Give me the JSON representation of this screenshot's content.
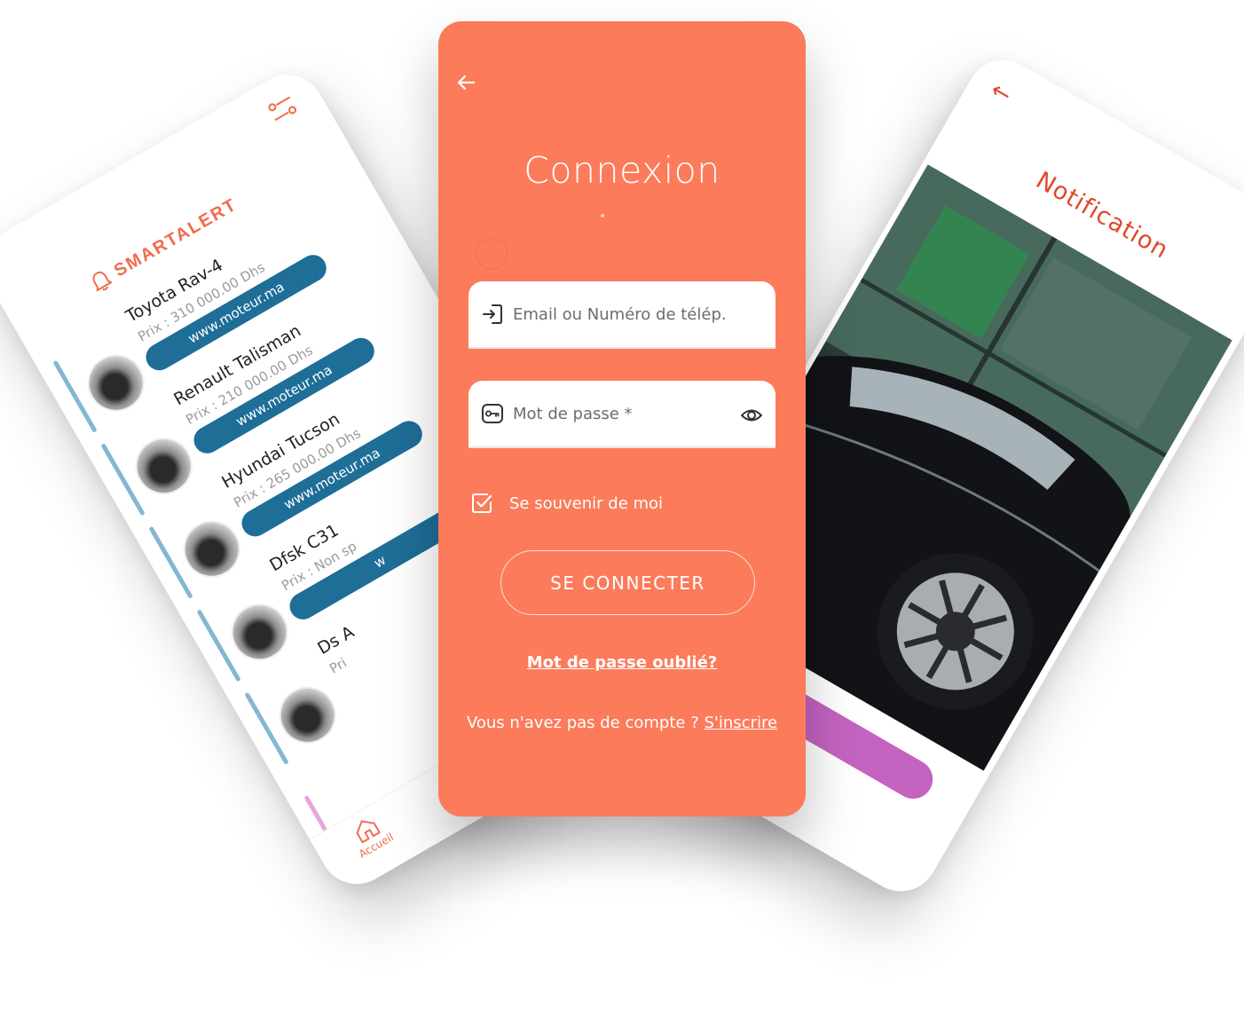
{
  "colors": {
    "accent": "#fb7b5b",
    "brand_red": "#f26b4b",
    "link_blue": "#1e6e98",
    "list_accent": "#84b7d2",
    "notif_accent": "#e0472a",
    "notif_bar": "#c463c0"
  },
  "left_app": {
    "brand": "SMARTALERT",
    "filter_icon": "sliders-icon",
    "cars": [
      {
        "name": "Toyota Rav-4",
        "price": "Prix : 310 000.00 Dhs",
        "link": "www.moteur.ma"
      },
      {
        "name": "Renault Talisman",
        "price": "Prix : 210 000.00 Dhs",
        "link": "www.moteur.ma"
      },
      {
        "name": "Hyundai Tucson",
        "price": "Prix : 265 000.00 Dhs",
        "link": "www.moteur.ma"
      },
      {
        "name": "Dfsk C31",
        "price": "Prix : Non sp",
        "link": "w"
      },
      {
        "name": "Ds A",
        "price": "Pri",
        "link": ""
      }
    ],
    "nav": {
      "home_label": "Accueil"
    }
  },
  "login": {
    "title": "Connexion",
    "email_placeholder": "Email ou Numéro de télép...",
    "password_placeholder": "Mot de passe *",
    "remember_label": "Se souvenir de moi",
    "remember_checked": true,
    "connect_label": "SE CONNECTER",
    "forgot_label": "Mot de passe oublié?",
    "no_account_text": "Vous n'avez pas de compte ?",
    "signup_label": "S'inscrire"
  },
  "notification_app": {
    "title": "Notification",
    "back_icon": "arrow-left-icon"
  }
}
